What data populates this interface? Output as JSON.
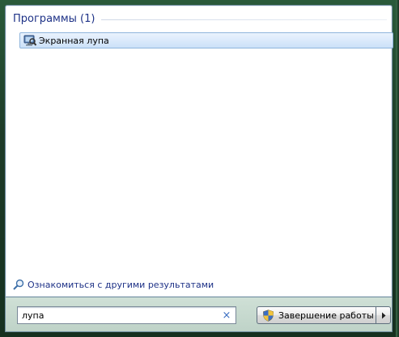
{
  "results": {
    "group_title": "Программы (1)",
    "items": [
      {
        "label": "Экранная лупа",
        "icon": "magnifier-app-icon"
      }
    ]
  },
  "see_more": {
    "label": "Ознакомиться с другими результатами",
    "icon": "search-icon"
  },
  "search": {
    "value": "лупа",
    "clear_label": "×"
  },
  "shutdown": {
    "label": "Завершение работы",
    "icon": "uac-shield-icon",
    "options_icon": "chevron-right-icon"
  },
  "colors": {
    "accent_text": "#1e3287",
    "selection_border": "#8fb5dc",
    "frame": "#1f3d2a"
  }
}
